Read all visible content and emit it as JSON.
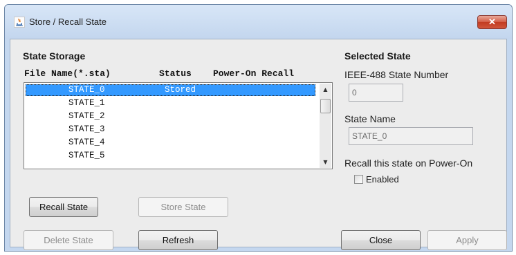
{
  "window": {
    "title": "Store / Recall State",
    "close_label": "✕"
  },
  "storage": {
    "heading": "State Storage",
    "columns": [
      "File Name(*.sta)",
      "Status",
      "Power-On Recall"
    ],
    "rows": [
      {
        "name": "STATE_0",
        "status": "Stored",
        "power_on": "",
        "selected": true
      },
      {
        "name": "STATE_1",
        "status": "",
        "power_on": ""
      },
      {
        "name": "STATE_2",
        "status": "",
        "power_on": ""
      },
      {
        "name": "STATE_3",
        "status": "",
        "power_on": ""
      },
      {
        "name": "STATE_4",
        "status": "",
        "power_on": ""
      },
      {
        "name": "STATE_5",
        "status": "",
        "power_on": ""
      }
    ],
    "scroll_up_icon": "scroll-up-arrow",
    "scroll_down_icon": "scroll-down-arrow"
  },
  "buttons": {
    "recall": "Recall State",
    "store": "Store State",
    "delete": "Delete State",
    "refresh": "Refresh",
    "close": "Close",
    "apply": "Apply"
  },
  "selected": {
    "heading": "Selected State",
    "number_label": "IEEE-488 State Number",
    "number_value": "0",
    "name_label": "State Name",
    "name_value": "STATE_0",
    "recall_label": "Recall this state on Power-On",
    "enabled_label": "Enabled",
    "enabled_checked": false
  },
  "colors": {
    "selection": "#3399ff",
    "close_button": "#c94a32",
    "title_bar": "#c4d7ef"
  }
}
